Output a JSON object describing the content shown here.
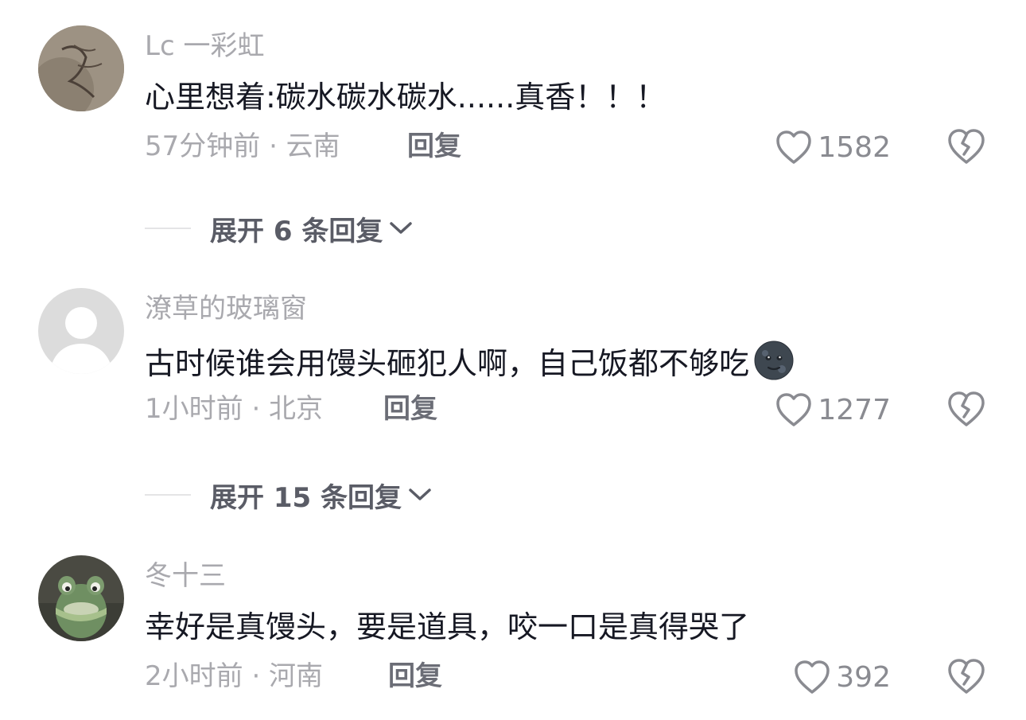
{
  "comments": [
    {
      "username": "Lc 一彩虹",
      "text": "心里想着:碳水碳水碳水......真香！！！",
      "time_location": "57分钟前 · 云南",
      "reply_label": "回复",
      "likes": "1582"
    },
    {
      "username": "潦草的玻璃窗",
      "text": "古时候谁会用馒头砸犯人啊，自己饭都不够吃",
      "emoji": "new-moon-face-emoji",
      "time_location": "1小时前 · 北京",
      "reply_label": "回复",
      "likes": "1277"
    },
    {
      "username": "冬十三",
      "text": "幸好是真馒头，要是道具，咬一口是真得哭了",
      "time_location": "2小时前 · 河南",
      "reply_label": "回复",
      "likes": "392"
    }
  ],
  "expanders": [
    {
      "label": "展开 6 条回复"
    },
    {
      "label": "展开 15 条回复"
    }
  ],
  "icons": {
    "like": "heart-outline-icon",
    "dislike": "broken-heart-icon",
    "expand": "chevron-down-icon"
  },
  "colors": {
    "primary_text": "#161823",
    "secondary_text": "#a9a9ae",
    "reply_text": "#6b6d76",
    "icon_gray": "#8a8b91"
  }
}
